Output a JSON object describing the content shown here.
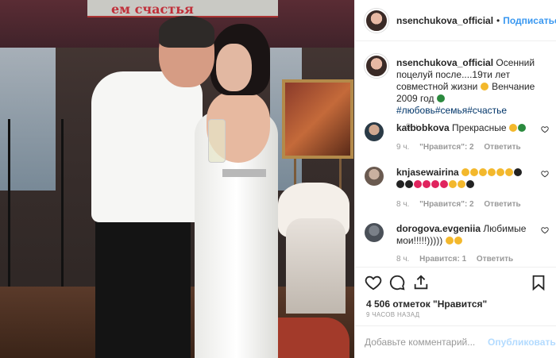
{
  "photo": {
    "banner_text": "ем счастья"
  },
  "header": {
    "username": "nsenchukova_official",
    "separator": "•",
    "follow_label": "Подписаться"
  },
  "caption": {
    "username": "nsenchukova_official",
    "text": "Осенний поцелуй после....19ти лет совместной жизни",
    "text2": "Венчание 2009 год",
    "tags": "#любовь#семья#счастье",
    "time": "9 ч."
  },
  "comments": [
    {
      "username": "katbobkova",
      "text": "Прекрасные",
      "time": "9 ч.",
      "likes": "\"Нравится\": 2",
      "reply": "Ответить"
    },
    {
      "username": "knjasewairina",
      "text": "",
      "time": "8 ч.",
      "likes": "\"Нравится\": 2",
      "reply": "Ответить"
    },
    {
      "username": "dorogova.evgeniia",
      "text": "Любимые мои!!!!!)))))",
      "time": "8 ч.",
      "likes": "Нравится: 1",
      "reply": "Ответить"
    }
  ],
  "stats": {
    "likes": "4 506 отметок \"Нравится\"",
    "date": "9 ЧАСОВ НАЗАД"
  },
  "composer": {
    "placeholder": "Добавьте комментарий...",
    "post_label": "Опубликовать"
  },
  "colors": {
    "link": "#3897f0",
    "muted": "#999999",
    "post_disabled": "#b3dbff"
  }
}
